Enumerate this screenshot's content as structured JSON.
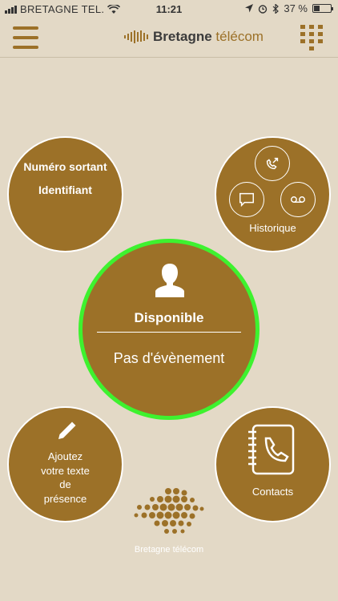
{
  "status_bar": {
    "carrier": "BRETAGNE TEL.",
    "time": "11:21",
    "battery": "37 %",
    "battery_level": 0.37
  },
  "header": {
    "brand_bold": "Bretagne",
    "brand_light": "télécom",
    "menu_icon": "hamburger-icon",
    "keypad_icon": "dialpad-icon"
  },
  "outgoing": {
    "line1": "Numéro sortant",
    "line2": "Identifiant"
  },
  "history": {
    "label": "Historique",
    "icons": [
      "missed-call-icon",
      "chat-bubble-icon",
      "voicemail-icon"
    ]
  },
  "presence": {
    "status": "Disponible",
    "event": "Pas d'évènement",
    "ring_color": "#3ef22f"
  },
  "presence_text": {
    "line1": "Ajoutez",
    "line2": "votre texte",
    "line3": "de",
    "line4": "présence"
  },
  "contacts": {
    "label": "Contacts"
  },
  "footer": {
    "brand": "Bretagne télécom"
  },
  "colors": {
    "background": "#e3d9c6",
    "brand_gold": "#9c7128",
    "white": "#ffffff"
  }
}
